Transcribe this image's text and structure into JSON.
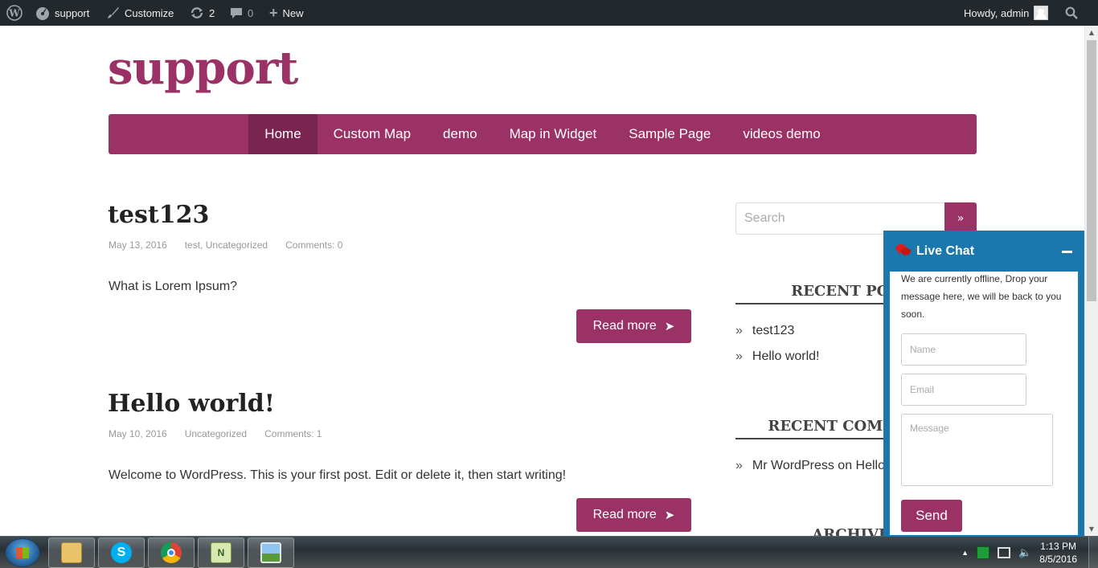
{
  "adminbar": {
    "site_name": "support",
    "customize": "Customize",
    "updates_count": "2",
    "comments_count": "0",
    "new_label": "New",
    "greeting": "Howdy, admin"
  },
  "site": {
    "title": "support",
    "nav": [
      "Home",
      "Custom Map",
      "demo",
      "Map in Widget",
      "Sample Page",
      "videos demo"
    ]
  },
  "posts": [
    {
      "title": "test123",
      "date": "May 13, 2016",
      "categories": "test, Uncategorized",
      "comments": "Comments: 0",
      "excerpt": "What is Lorem Ipsum?",
      "read_more": "Read more"
    },
    {
      "title": "Hello world!",
      "date": "May 10, 2016",
      "categories": "Uncategorized",
      "comments": "Comments: 1",
      "excerpt": "Welcome to WordPress. This is your first post. Edit or delete it, then start writing!",
      "read_more": "Read more"
    }
  ],
  "sidebar": {
    "search_placeholder": "Search",
    "search_button": "»",
    "recent_posts_title": "RECENT POSTS",
    "recent_posts": [
      "test123",
      "Hello world!"
    ],
    "recent_comments_title": "RECENT COMMENTS",
    "recent_comments": [
      "Mr WordPress on Hello world!"
    ],
    "archives_title": "ARCHIVES",
    "bullet": "»"
  },
  "live_chat": {
    "title": "Live Chat",
    "message": "We are currently offline, Drop your message here, we will be back to you soon.",
    "name_placeholder": "Name",
    "email_placeholder": "Email",
    "message_placeholder": "Message",
    "send": "Send"
  },
  "taskbar": {
    "time": "1:13 PM",
    "date": "8/5/2016"
  },
  "colors": {
    "brand": "#9b3266",
    "chat_accent": "#1a78ae",
    "adminbar": "#23282d"
  }
}
